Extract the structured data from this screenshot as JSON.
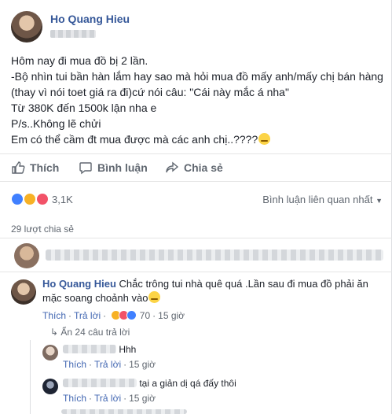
{
  "post": {
    "author": "Ho Quang Hieu",
    "lines": [
      "Hôm nay đi mua đồ bị 2 lần.",
      "-Bộ nhìn tui bần hàn lắm hay sao mà hỏi mua đồ mấy anh/mấy chị bán hàng",
      "(thay vì nói toet giá ra đi)cứ nói câu: \"Cái này mắc á nha\"",
      "Từ 380K đến 1500k lận nha e",
      "P/s..Không lẽ chửi",
      "Em có thể cầm đt mua được mà các anh chị..????"
    ]
  },
  "actions": {
    "like_label": "Thích",
    "comment_label": "Bình luận",
    "share_label": "Chia sẻ"
  },
  "reactions": {
    "count": "3,1K",
    "sort_label": "Bình luận liên quan nhất",
    "icons": [
      "like-reaction",
      "haha-reaction",
      "love-reaction"
    ],
    "colors": {
      "like": "#4080ff",
      "haha": "#f7b125",
      "love": "#f25268"
    }
  },
  "shares_text": "29 lượt chia sẻ",
  "comment": {
    "author": "Ho Quang Hieu",
    "text": "Chắc trông tui nhà quê quá .Lần sau đi mua đồ phải ăn mặc soang choảnh vào",
    "like_label": "Thích",
    "reply_label": "Trả lời",
    "reaction_count": "70",
    "time": "15 giờ"
  },
  "replies_toggle": "Ẩn 24 câu trả lời",
  "replies": [
    {
      "text": "Hhh",
      "like_label": "Thích",
      "reply_label": "Trả lời",
      "time": "15 giờ"
    },
    {
      "text": "tại a giản dị qá đấy thôi",
      "like_label": "Thích",
      "reply_label": "Trả lời",
      "time": "15 giờ"
    }
  ]
}
